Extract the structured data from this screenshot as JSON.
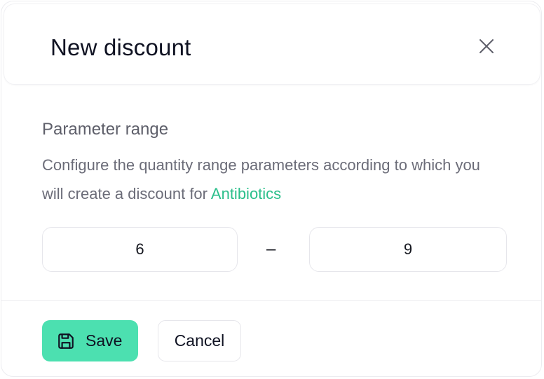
{
  "dialog": {
    "title": "New discount",
    "close_icon": "close-icon"
  },
  "parameter_range": {
    "heading": "Parameter range",
    "description_prefix": "Configure the quantity range parameters according to which you will create a discount for ",
    "product_name": "Antibiotics",
    "min_value": "6",
    "separator": "–",
    "max_value": "9"
  },
  "footer": {
    "save_label": "Save",
    "save_icon": "save-icon",
    "cancel_label": "Cancel"
  },
  "colors": {
    "accent": "#4ce0b0",
    "link": "#2bbf8b",
    "title_text": "#0f1222",
    "muted_text": "#6b6c78"
  }
}
